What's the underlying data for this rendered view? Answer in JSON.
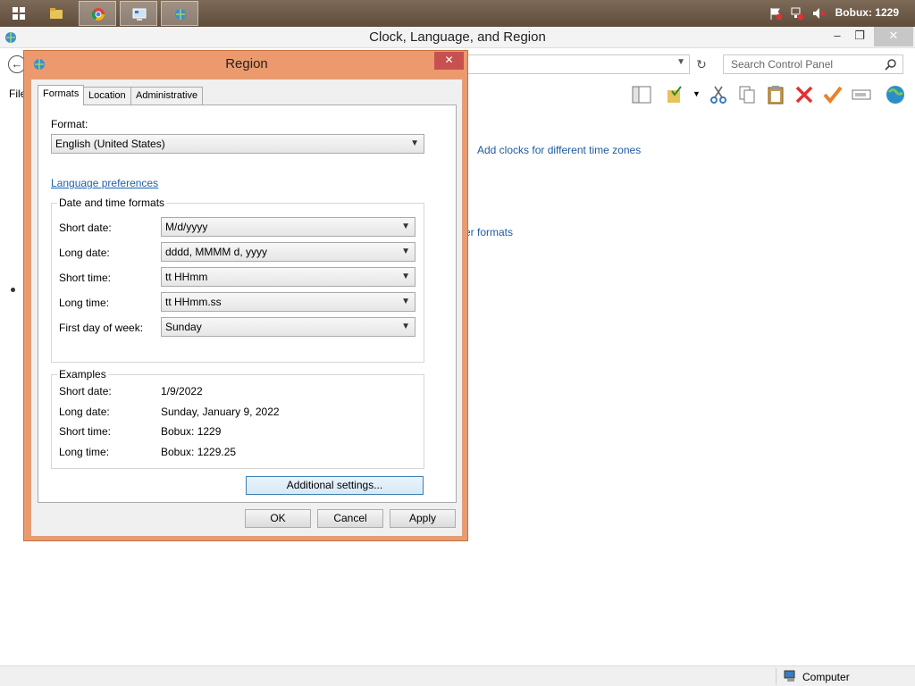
{
  "taskbar": {
    "apps": [
      "start",
      "file-explorer",
      "chrome",
      "control-panel",
      "clock-language-region"
    ],
    "tray_text": "Bobux: 1229"
  },
  "cp_window": {
    "title": "Clock, Language, and Region",
    "window_controls": {
      "minimize": "–",
      "restore": "❐",
      "close": "✕"
    },
    "search_placeholder": "Search Control Panel",
    "menu_file": "File",
    "links": {
      "add_clocks": "Add clocks for different time zones",
      "other_formats": "er formats"
    },
    "status": "Computer"
  },
  "dialog": {
    "title": "Region",
    "close": "✕",
    "tabs": [
      "Formats",
      "Location",
      "Administrative"
    ],
    "format_label": "Format:",
    "format_value": "English (United States)",
    "language_preferences": "Language preferences",
    "date_time_group": "Date and time formats",
    "fields": [
      {
        "label": "Short date:",
        "value": "M/d/yyyy"
      },
      {
        "label": "Long date:",
        "value": "dddd, MMMM d, yyyy"
      },
      {
        "label": "Short time:",
        "value": "tt HHmm"
      },
      {
        "label": "Long time:",
        "value": "tt HHmm.ss"
      },
      {
        "label": "First day of week:",
        "value": "Sunday"
      }
    ],
    "examples_group": "Examples",
    "examples": [
      {
        "label": "Short date:",
        "value": "1/9/2022"
      },
      {
        "label": "Long date:",
        "value": "Sunday, January 9, 2022"
      },
      {
        "label": "Short time:",
        "value": "Bobux: 1229"
      },
      {
        "label": "Long time:",
        "value": "Bobux: 1229.25"
      }
    ],
    "additional_settings": "Additional settings...",
    "ok": "OK",
    "cancel": "Cancel",
    "apply": "Apply"
  },
  "colors": {
    "dialog_frame": "#ec9a6d",
    "link": "#1c62b0",
    "taskbar": "#6e5a48"
  }
}
